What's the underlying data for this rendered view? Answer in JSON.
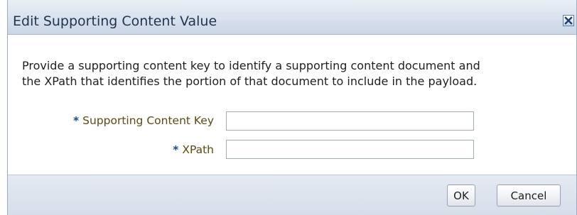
{
  "dialog": {
    "title": "Edit Supporting Content Value",
    "close_icon": "close-icon",
    "message_lines": [
      "Provide a supporting content key to identify a supporting content document and",
      "the XPath that identifies the portion of that document to include in the payload."
    ],
    "fields": [
      {
        "required_marker": "*",
        "label": "Supporting Content Key",
        "value": ""
      },
      {
        "required_marker": "*",
        "label": "XPath",
        "value": ""
      }
    ],
    "buttons": {
      "ok_label": "OK",
      "cancel_label": "Cancel"
    }
  },
  "colors": {
    "title_text": "#20364f",
    "label_text": "#5b4a12",
    "required_star": "#1a4c8a",
    "header_gradient_top": "#eaeff6",
    "header_gradient_bottom": "#cbd6e5"
  }
}
